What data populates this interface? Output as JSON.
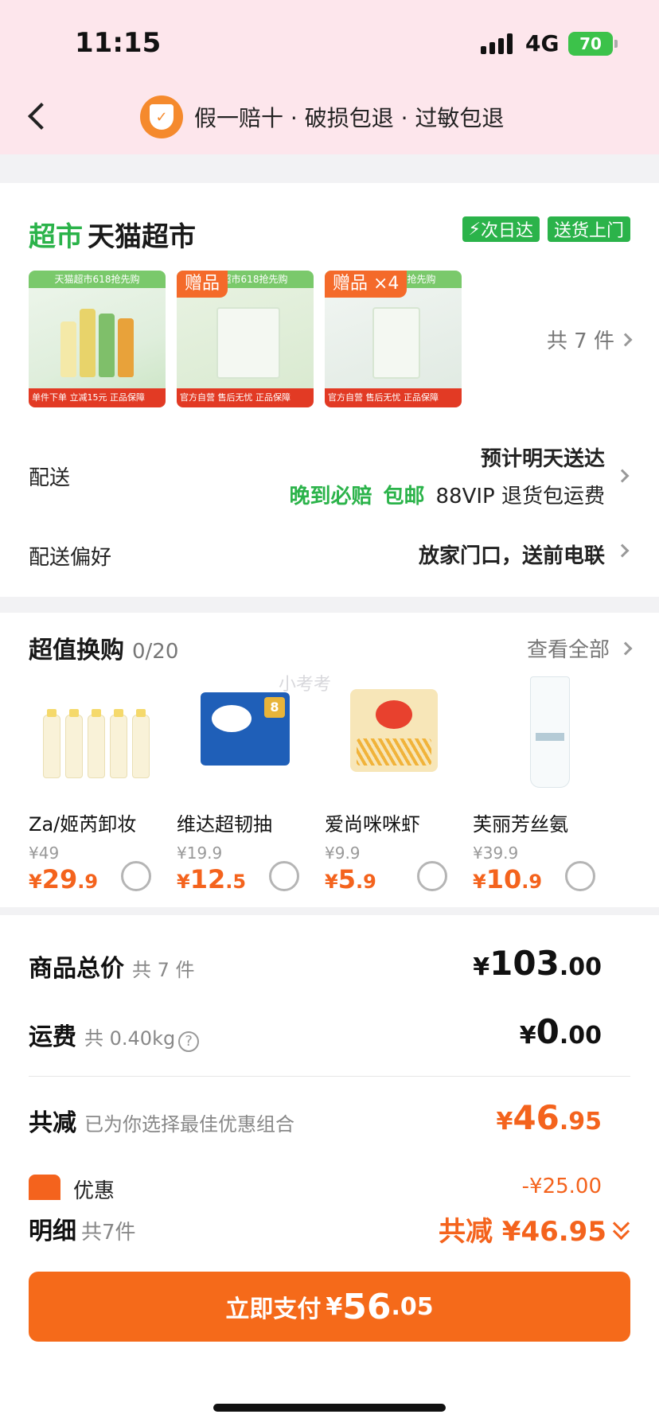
{
  "status_bar": {
    "time": "11:15",
    "network": "4G",
    "battery": "70"
  },
  "nav": {
    "guarantee_text": "假一赔十 · 破损包退 · 过敏包退"
  },
  "store": {
    "tag": "超市",
    "name": "天猫超市",
    "badges": [
      "次日达",
      "送货上门"
    ],
    "thumbnails": [
      {
        "top_text": "天猫超市618抢先购",
        "gift_label": "",
        "bottom_text": "单件下单 立减15元 正品保障"
      },
      {
        "top_text": "天猫超市618抢先购",
        "gift_label": "赠品",
        "bottom_text": "官方自营 售后无忧 正品保障"
      },
      {
        "top_text": "天猫超市618抢先购",
        "gift_label": "赠品 ×4",
        "bottom_text": "官方自营 售后无忧 正品保障"
      }
    ],
    "total_items": "共 7 件"
  },
  "delivery": {
    "label": "配送",
    "eta": "预计明天送达",
    "tag_late": "晚到必赔",
    "tag_free": "包邮",
    "tag_vip": "88VIP 退货包运费"
  },
  "preference": {
    "label": "配送偏好",
    "value": "放家门口，送前电联"
  },
  "deals": {
    "title": "超值换购",
    "count": "0/20",
    "view_all": "查看全部",
    "items": [
      {
        "name": "Za/姬芮卸妆",
        "old_price": "¥49",
        "price_int": "29",
        "price_dec": ".9"
      },
      {
        "name": "维达超韧抽",
        "old_price": "¥19.9",
        "price_int": "12",
        "price_dec": ".5"
      },
      {
        "name": "爱尚咪咪虾",
        "old_price": "¥9.9",
        "price_int": "5",
        "price_dec": ".9"
      },
      {
        "name": "芙丽芳丝氨",
        "old_price": "¥39.9",
        "price_int": "10",
        "price_dec": ".9"
      }
    ]
  },
  "summary": {
    "goods_label": "商品总价",
    "goods_sub": "共 7 件",
    "goods_int": "103",
    "goods_dec": ".00",
    "shipping_label": "运费",
    "shipping_sub": "共 0.40kg",
    "shipping_int": "0",
    "shipping_dec": ".00",
    "discount_label": "共减",
    "discount_sub": "已为你选择最佳优惠组合",
    "discount_int": "46",
    "discount_dec": ".95",
    "coupon_label": "优惠",
    "coupon_val": "-¥25.00"
  },
  "bottom": {
    "detail_label": "明细",
    "detail_sub": "共7件",
    "detail_total": "共减 ¥46.95",
    "pay_label": "立即支付",
    "pay_yen": "¥",
    "pay_int": "56",
    "pay_dec": ".05"
  },
  "watermark": "小考考",
  "colors": {
    "accent": "#f4631d",
    "green": "#2bb34a",
    "header_bg": "#fde6ec"
  }
}
